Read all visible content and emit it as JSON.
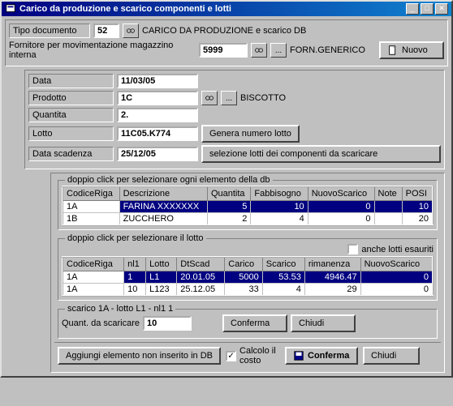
{
  "titlebar": {
    "title": "Carico da produzione e scarico componenti e lotti"
  },
  "top": {
    "tipo_doc_label": "Tipo documento",
    "tipo_doc_value": "52",
    "tipo_doc_desc": "CARICO DA PRODUZIONE e scarico DB",
    "fornitore_label": "Fornitore per movimentazione magazzino interna",
    "fornitore_value": "5999",
    "fornitore_desc": "FORN.GENERICO",
    "nuovo_btn": "Nuovo"
  },
  "mid": {
    "data_label": "Data",
    "data_value": "11/03/05",
    "prodotto_label": "Prodotto",
    "prodotto_value": "1C",
    "prodotto_desc": "BISCOTTO",
    "quantita_label": "Quantita",
    "quantita_value": "2.",
    "lotto_label": "Lotto",
    "lotto_value": "11C05.K774",
    "genera_btn": "Genera numero lotto",
    "scadenza_label": "Data scadenza",
    "scadenza_value": "25/12/05",
    "selezione_btn": "selezione lotti dei componenti da scaricare"
  },
  "db_section": {
    "legend": "doppio click per selezionare ogni elemento della db",
    "headers": [
      "CodiceRiga",
      "Descrizione",
      "Quantita",
      "Fabbisogno",
      "NuovoScarico",
      "Note",
      "POSI"
    ],
    "rows": [
      {
        "sel": true,
        "cells": [
          "1A",
          "FARINA XXXXXXX",
          "5",
          "10",
          "0",
          "",
          "10"
        ]
      },
      {
        "sel": false,
        "cells": [
          "1B",
          "ZUCCHERO",
          "2",
          "4",
          "0",
          "",
          "20"
        ]
      }
    ]
  },
  "lotto_section": {
    "legend": "doppio click per selezionare il lotto",
    "anche_esauriti": "anche lotti esauriti",
    "headers": [
      "CodiceRiga",
      "nl1",
      "Lotto",
      "DtScad",
      "Carico",
      "Scarico",
      "rimanenza",
      "NuovoScarico"
    ],
    "rows": [
      {
        "sel": true,
        "cells": [
          "1A",
          "1",
          "L1",
          "20.01.05",
          "5000",
          "53.53",
          "4946.47",
          "0"
        ]
      },
      {
        "sel": false,
        "cells": [
          "1A",
          "10",
          "L123",
          "25.12.05",
          "33",
          "4",
          "29",
          "0"
        ]
      }
    ]
  },
  "scarico": {
    "legend": "scarico 1A - lotto L1 - nl1 1",
    "quant_label": "Quant. da scaricare",
    "quant_value": "10",
    "conferma_btn": "Conferma",
    "chiudi_btn": "Chiudi"
  },
  "footer": {
    "aggiungi_btn": "Aggiungi elemento non inserito in DB",
    "calcolo_label": "Calcolo il costo",
    "conferma_btn": "Conferma",
    "chiudi_btn": "Chiudi"
  }
}
